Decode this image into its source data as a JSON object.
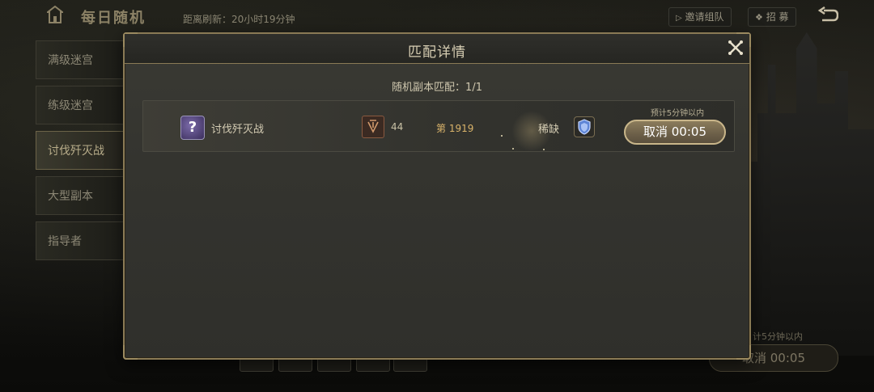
{
  "topbar": {
    "title": "每日随机",
    "refresh": "距离刷新：20小时19分钟",
    "invite_label": "邀请组队",
    "recruit_label": "招 募"
  },
  "sidebar": {
    "items": [
      {
        "label": "满级迷宫"
      },
      {
        "label": "练级迷宫"
      },
      {
        "label": "讨伐歼灭战"
      },
      {
        "label": "大型副本"
      },
      {
        "label": "指导者"
      }
    ]
  },
  "background": {
    "hint": "计5分钟以内",
    "cancel_label": "取消 00:05"
  },
  "dialog": {
    "title": "匹配详情",
    "summary_label": "随机副本匹配：",
    "summary_value": "1/1",
    "row": {
      "name": "讨伐歼灭战",
      "level": "44",
      "rank": "第 1919",
      "rarity": "稀缺",
      "eta": "预计5分钟以内",
      "cancel_label": "取消 00:05"
    }
  },
  "colors": {
    "accent_gold": "#c9b68a",
    "rank_gold": "#d9b36a",
    "dialog_bg": "#34342f"
  }
}
